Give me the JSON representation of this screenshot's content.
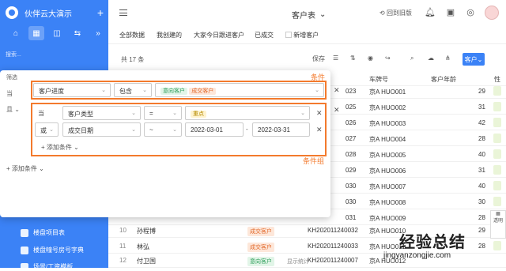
{
  "app": {
    "name": "伙伴云大演示"
  },
  "sidebar": {
    "search_placeholder": "搜索...",
    "items": [
      {
        "label": "楼盘项目表"
      },
      {
        "label": "楼盘幢号房号字典"
      },
      {
        "label": "场景/工资模板"
      }
    ]
  },
  "header": {
    "title": "客户表",
    "go_back": "回到旧版"
  },
  "tabs": [
    "全部数据",
    "我创建的",
    "大家今日跟进客户",
    "已成交",
    "新增客户"
  ],
  "toolbar": {
    "total": "共 17 条",
    "save": "保存",
    "customer_btn": "客户"
  },
  "table": {
    "headers": {
      "plate": "车牌号",
      "age": "客户年龄",
      "extra": "性"
    },
    "rows": [
      {
        "code": "023",
        "plate": "京A HUO001",
        "age": "29"
      },
      {
        "code": "025",
        "plate": "京A HUO002",
        "age": "31"
      },
      {
        "code": "026",
        "plate": "京A HUO003",
        "age": "42"
      },
      {
        "code": "027",
        "plate": "京A HUO004",
        "age": "28"
      },
      {
        "code": "028",
        "plate": "京A HUO005",
        "age": "40"
      },
      {
        "code": "029",
        "plate": "京A HUO006",
        "age": "31"
      },
      {
        "code": "030",
        "plate": "京A HUO007",
        "age": "40"
      },
      {
        "code": "030",
        "plate": "京A HUO008",
        "age": "30"
      },
      {
        "code": "031",
        "plate": "京A HUO009",
        "age": "28"
      },
      {
        "num": "10",
        "name": "孙程博",
        "status": "成交客户",
        "code": "KH202011240032",
        "plate": "京A HUO010",
        "age": "29"
      },
      {
        "num": "11",
        "name": "林弘",
        "status": "成交客户",
        "code": "KH202011240033",
        "plate": "京A HUO011",
        "age": "28"
      },
      {
        "num": "12",
        "name": "付卫国",
        "status": "意向客户",
        "code": "KH202011240007",
        "plate": "京A HUO012",
        "age": ""
      }
    ],
    "footer": "显示统计"
  },
  "filter": {
    "label": "筛选",
    "when": "当",
    "and": "且",
    "condition": {
      "field": "客户进度",
      "op": "包含",
      "tags": [
        "意向客户",
        "成交客户"
      ]
    },
    "group": {
      "row1": {
        "prefix": "当",
        "field": "客户类型",
        "op": "=",
        "value": "重点"
      },
      "row2": {
        "prefix": "或",
        "field": "成交日期",
        "op": "~",
        "from": "2022-03-01",
        "to": "2022-03-31"
      },
      "add_condition": "+ 添加条件"
    },
    "add_condition": "+ 添加条件",
    "annot_condition": "条件",
    "annot_group": "条件组"
  },
  "watermark": {
    "cn": "经验总结",
    "url": "jingyanzongjie.com"
  },
  "float_panel": {
    "label": "透明"
  }
}
